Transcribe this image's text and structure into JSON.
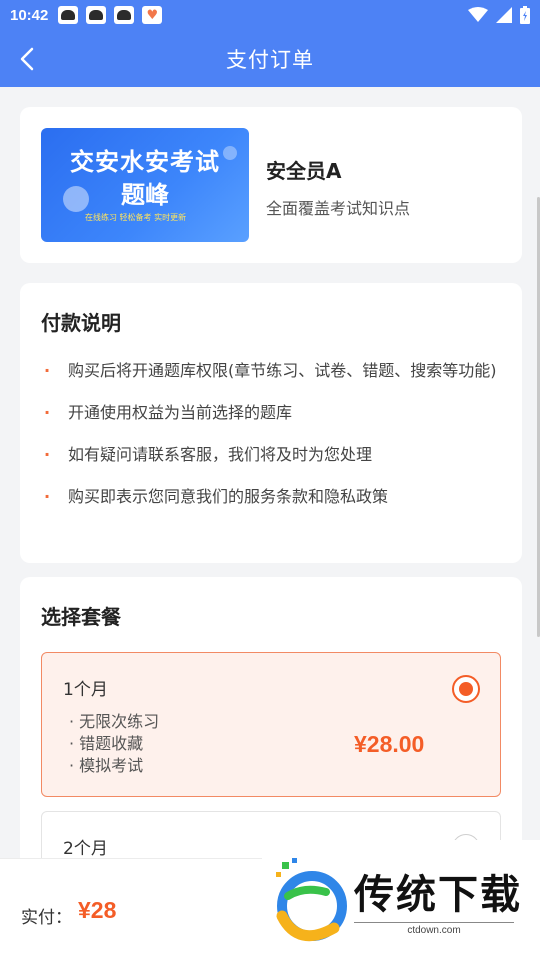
{
  "status_bar": {
    "time": "10:42"
  },
  "header": {
    "title": "支付订单"
  },
  "product": {
    "banner_line1": "交安水安考试",
    "banner_line2": "题峰",
    "banner_tagline": "在线练习 轻松备考 实时更新",
    "name": "安全员A",
    "description": "全面覆盖考试知识点"
  },
  "payment_notes": {
    "title": "付款说明",
    "items": [
      "购买后将开通题库权限(章节练习、试卷、错题、搜索等功能)",
      "开通使用权益为当前选择的题库",
      "如有疑问请联系客服，我们将及时为您处理",
      "购买即表示您同意我们的服务条款和隐私政策"
    ]
  },
  "plans": {
    "title": "选择套餐",
    "options": [
      {
        "name": "1个月",
        "features": [
          "无限次练习",
          "错题收藏",
          "模拟考试"
        ],
        "price": "¥28.00",
        "selected": true
      },
      {
        "name": "2个月",
        "selected": false
      }
    ]
  },
  "checkout": {
    "label": "实付：",
    "total": "¥28"
  },
  "watermark": {
    "text": "传统下载",
    "sub": "ctdown.com"
  },
  "colors": {
    "primary": "#4d82f5",
    "accent": "#f45d27",
    "selected_bg": "#fef1ec"
  }
}
